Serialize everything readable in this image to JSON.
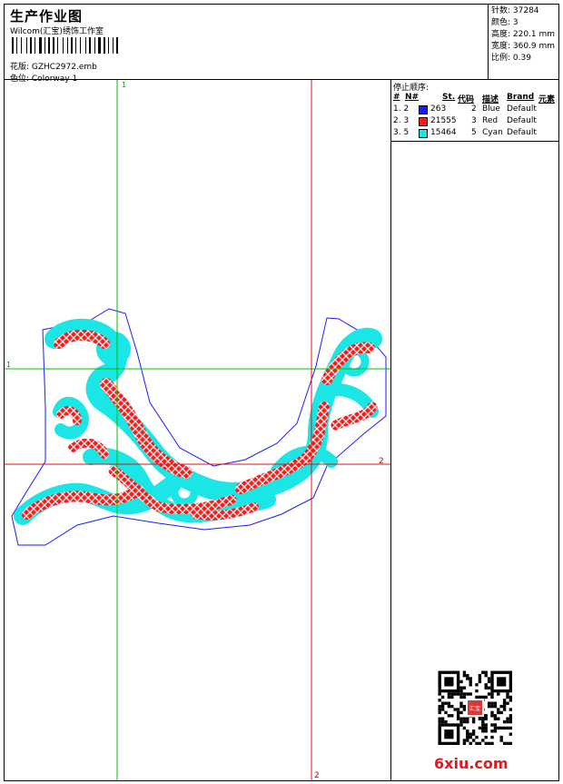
{
  "header": {
    "title": "生产作业图",
    "studio": "Wilcom(汇宝)绣饰工作室",
    "design_label": "花版: GZHC2972.emb",
    "colorway_label": "色位: Colorway 1"
  },
  "stats": {
    "stitches": "针数: 37284",
    "colors": "颜色: 3",
    "height": "高度: 220.1 mm",
    "width": "宽度: 360.9 mm",
    "scale": "比例: 0.39"
  },
  "stop_list": {
    "title": "停止顺序:",
    "headers": [
      "#",
      "N#",
      "St.",
      "代码",
      "描述",
      "Brand",
      "元素"
    ],
    "rows": [
      {
        "idx": "1. 2",
        "color": "#1a1aff",
        "stitches": "263",
        "code": "2",
        "desc": "Blue",
        "brand": "Default"
      },
      {
        "idx": "2. 3",
        "color": "#ff1a1a",
        "stitches": "21555",
        "code": "3",
        "desc": "Red",
        "brand": "Default"
      },
      {
        "idx": "3. 5",
        "color": "#1ae6e6",
        "stitches": "15464",
        "code": "5",
        "desc": "Cyan",
        "brand": "Default"
      }
    ]
  },
  "guides": {
    "v1": "1",
    "h1": "1",
    "v2": "2",
    "h2": "2"
  },
  "watermark": "6xiu.com",
  "qr_seal_text": "汇宝"
}
